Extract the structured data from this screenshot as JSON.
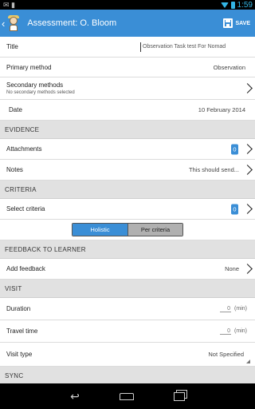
{
  "status": {
    "time": "1:59",
    "left_icons": "✉ ▮"
  },
  "action_bar": {
    "back_icon": "chevron-left-icon",
    "title": "Assessment: O. Bloom",
    "save_label": "SAVE"
  },
  "fields": {
    "title": {
      "label": "Title",
      "value": "Observation Task test For Nomad"
    },
    "primary_method": {
      "label": "Primary method",
      "value": "Observation"
    },
    "secondary_methods": {
      "label": "Secondary methods",
      "sub": "No secondary methods selected"
    },
    "date": {
      "label": "Date",
      "value": "10 February 2014"
    }
  },
  "sections": {
    "evidence": "EVIDENCE",
    "criteria": "CRITERIA",
    "feedback": "FEEDBACK TO LEARNER",
    "visit": "VISIT",
    "sync": "SYNC"
  },
  "evidence": {
    "attachments": {
      "label": "Attachments",
      "count": "0"
    },
    "notes": {
      "label": "Notes",
      "value": "This should send..."
    }
  },
  "criteria": {
    "select": {
      "label": "Select criteria",
      "count": "0"
    },
    "toggle": {
      "holistic": "Holistic",
      "per_criteria": "Per criteria",
      "selected": "Holistic"
    }
  },
  "feedback": {
    "label": "Add feedback",
    "value": "None"
  },
  "visit": {
    "duration": {
      "label": "Duration",
      "value": "0",
      "unit": "(min)"
    },
    "travel_time": {
      "label": "Travel time",
      "value": "0",
      "unit": "(min)"
    },
    "visit_type": {
      "label": "Visit type",
      "value": "Not Specified"
    }
  },
  "nav": {
    "back": "↩",
    "home": "home-icon",
    "recent": "recent-apps-icon"
  },
  "colors": {
    "accent": "#3a8ed6",
    "section_bg": "#e1e1e1",
    "status_blue": "#33b5e5"
  }
}
